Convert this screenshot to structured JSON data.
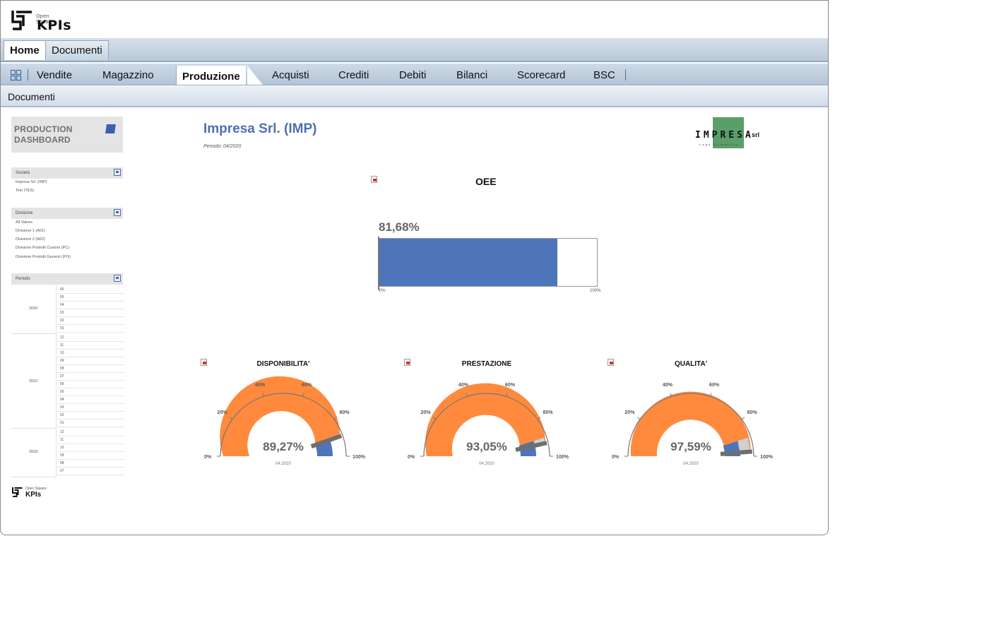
{
  "app": {
    "logo_small": "Open Square",
    "logo_big": "KPIs"
  },
  "top_tabs": [
    {
      "label": "Home",
      "active": true
    },
    {
      "label": "Documenti",
      "active": false
    }
  ],
  "module_tabs": [
    {
      "label": "Vendite"
    },
    {
      "label": "Magazzino"
    },
    {
      "label": "Produzione",
      "active": true
    },
    {
      "label": "Acquisti"
    },
    {
      "label": "Crediti"
    },
    {
      "label": "Debiti"
    },
    {
      "label": "Bilanci"
    },
    {
      "label": "Scorecard"
    },
    {
      "label": "BSC"
    }
  ],
  "subbar": {
    "label": "Documenti"
  },
  "sidebar": {
    "title": "PRODUCTION DASHBOARD",
    "societa": {
      "header": "Società",
      "items": [
        "Impresa Srl. (IMP)",
        "Test (TES)"
      ]
    },
    "divisione": {
      "header": "Divisione",
      "items": [
        "All Values",
        "Divisione 1 (A01)",
        "Divisione 2 (A02)",
        "Divisione Prodotti Custom (PC)",
        "Divisione Prodotti Generici (PG)"
      ]
    },
    "periodo": {
      "header": "Periodo",
      "years": [
        {
          "year": "2020",
          "months": [
            "06",
            "05",
            "04",
            "03",
            "02",
            "01"
          ]
        },
        {
          "year": "2019",
          "months": [
            "12",
            "11",
            "10",
            "09",
            "08",
            "07",
            "06",
            "05",
            "04",
            "03",
            "02",
            "01"
          ]
        },
        {
          "year": "2018",
          "months": [
            "12",
            "11",
            "10",
            "09",
            "08",
            "07"
          ]
        }
      ]
    }
  },
  "main": {
    "company": "Impresa Srl. (IMP)",
    "period": "Periodo: 04/2020",
    "logo": {
      "text": "IMPRESA",
      "suffix": "srl",
      "sub": "Lago Scientific"
    }
  },
  "oee": {
    "title": "OEE",
    "value_label": "81,68%",
    "value": 81.68,
    "min_label": "0%",
    "max_label": "100%",
    "color": "#4e74ba"
  },
  "gauges": [
    {
      "title": "DISPONIBILITA'",
      "value": 89.27,
      "value_label": "89,27%",
      "period": "04.2020"
    },
    {
      "title": "PRESTAZIONE",
      "value": 93.05,
      "value_label": "93,05%",
      "period": "04.2020"
    },
    {
      "title": "QUALITA'",
      "value": 97.59,
      "value_label": "97,59%",
      "period": "04.2020"
    }
  ],
  "gauge_ticks": [
    "0%",
    "20%",
    "40%",
    "60%",
    "80%",
    "100%"
  ],
  "colors": {
    "accent_blue": "#4e6fb0",
    "gauge_orange": "#ff8a3d",
    "gauge_blue": "#4e74ba"
  }
}
